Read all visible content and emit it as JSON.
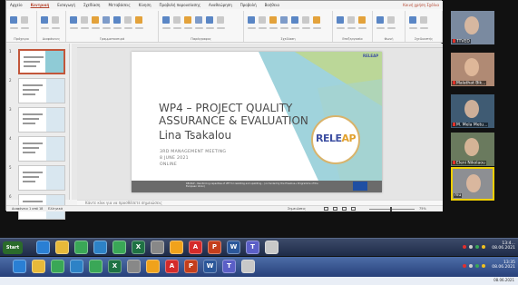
{
  "ppt": {
    "menu": [
      "Αρχείο",
      "Κεντρική",
      "Εισαγωγή",
      "Σχεδίαση",
      "Μεταβάσεις",
      "Κίνηση",
      "Προβολή παρουσίασης",
      "Αναθεώρηση",
      "Προβολή",
      "Βοήθεια"
    ],
    "active_menu_index": 1,
    "share_label": "Κοινή χρήση",
    "comments_label": "Σχόλια",
    "ribbon_groups": [
      "Πρόχειρο",
      "Διαφάνειες",
      "Γραμματοσειρά",
      "Παράγραφος",
      "Σχεδίαση",
      "Επεξεργασία",
      "Φωνή",
      "Σχεδιαστής"
    ],
    "thumbnails": [
      "1",
      "2",
      "3",
      "4",
      "5",
      "6"
    ],
    "selected_thumbnail": 0,
    "notes_placeholder": "Κάντε κλικ για να προσθέσετε σημειώσεις",
    "status": {
      "slide_counter": "Διαφάνεια 1 από 18",
      "language": "Ελληνικά",
      "notes_button": "Σημειώσεις",
      "zoom": "75%"
    }
  },
  "slide": {
    "title": "WP4 – PROJECT QUALITY ASSURANCE & EVALUATION",
    "author": "Lina Tsakalou",
    "meeting": "3RD MANAGEMENT MEETING",
    "date": "8 JUNE 2021",
    "mode": "ONLINE",
    "logo_part1": "RELE",
    "logo_part2": "AP",
    "footer_text": "RELEAP – Reinforcing capacities of VET for reskilling and upskilling... (co-funded by the Erasmus+ Programme of the European Union)",
    "colors": {
      "teal": "#8fcbd6",
      "lime": "#c6d97a",
      "footer": "#6b6b6b",
      "logo_blue": "#3d4fa1",
      "logo_orange": "#e2a12d"
    }
  },
  "participants": [
    {
      "name": "TTVED",
      "mic_off": true,
      "bg": "#7a8aa0"
    },
    {
      "name": "Malathat Bik...",
      "mic_off": true,
      "bg": "#b08a74"
    },
    {
      "name": "M. Mela Metu...",
      "mic_off": true,
      "bg": "#3f5b73"
    },
    {
      "name": "Eleni Nikolaou",
      "mic_off": true,
      "bg": "#6a7a5e"
    },
    {
      "name": "mu",
      "mic_off": false,
      "bg": "#8d8f93",
      "active": true
    }
  ],
  "taskbar1": {
    "start_label": "Start",
    "icons": [
      "ie-icon",
      "folder-icon",
      "chrome-icon",
      "edge-icon",
      "chrome-icon",
      "excel-icon",
      "media-icon",
      "onedrive-icon",
      "acrobat-icon",
      "powerpoint-icon",
      "word-icon",
      "teams-icon",
      "notes-icon"
    ],
    "time": "13:4…",
    "date": "08.06.2021"
  },
  "taskbar2": {
    "icons": [
      "ie-icon",
      "folder-icon",
      "chrome-icon",
      "edge-icon",
      "chrome-icon",
      "excel-icon",
      "media-icon",
      "onedrive-icon",
      "acrobat-icon",
      "powerpoint-icon",
      "word-icon",
      "teams-icon",
      "notes-icon"
    ],
    "time": "13:35",
    "date": "08.06.2021"
  },
  "bottom_strip_time": "08.06.2021"
}
